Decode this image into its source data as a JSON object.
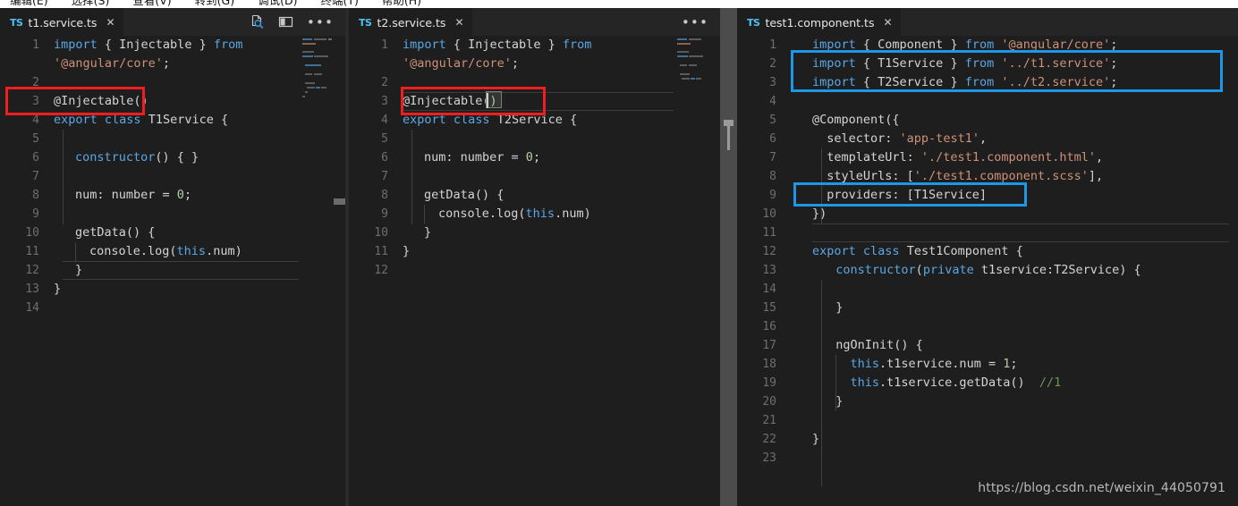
{
  "menubar": {
    "items": [
      "编辑(E)",
      "选择(S)",
      "查看(V)",
      "转到(G)",
      "调试(D)",
      "终端(T)",
      "帮助(H)"
    ]
  },
  "editor_groups": [
    {
      "tab": {
        "file_type": "TS",
        "filename": "t1.service.ts",
        "close_label": "✕"
      },
      "actions": [
        {
          "name": "open-preview-icon",
          "label": ""
        },
        {
          "name": "split-editor-icon",
          "label": ""
        },
        {
          "name": "more-actions-icon",
          "label": "•••"
        }
      ],
      "lines": [
        {
          "n": "1",
          "text": "import { Injectable } from"
        },
        {
          "n": "",
          "text": "'@angular/core';"
        },
        {
          "n": "2",
          "text": ""
        },
        {
          "n": "3",
          "text": "@Injectable()"
        },
        {
          "n": "4",
          "text": "export class T1Service {"
        },
        {
          "n": "5",
          "text": ""
        },
        {
          "n": "6",
          "text": "  constructor() { }"
        },
        {
          "n": "7",
          "text": ""
        },
        {
          "n": "8",
          "text": "  num: number = 0;"
        },
        {
          "n": "9",
          "text": ""
        },
        {
          "n": "10",
          "text": "  getData() {"
        },
        {
          "n": "11",
          "text": "    console.log(this.num)"
        },
        {
          "n": "12",
          "text": "  }"
        },
        {
          "n": "13",
          "text": "}"
        },
        {
          "n": "14",
          "text": ""
        }
      ]
    },
    {
      "tab": {
        "file_type": "TS",
        "filename": "t2.service.ts",
        "close_label": "✕"
      },
      "actions": [
        {
          "name": "more-actions-icon",
          "label": "•••"
        }
      ],
      "lines": [
        {
          "n": "1",
          "text": "import { Injectable } from"
        },
        {
          "n": "",
          "text": "'@angular/core';"
        },
        {
          "n": "2",
          "text": ""
        },
        {
          "n": "3",
          "text": "@Injectable()"
        },
        {
          "n": "4",
          "text": "export class T2Service {"
        },
        {
          "n": "5",
          "text": ""
        },
        {
          "n": "6",
          "text": "  num: number = 0;"
        },
        {
          "n": "7",
          "text": ""
        },
        {
          "n": "8",
          "text": "  getData() {"
        },
        {
          "n": "9",
          "text": "    console.log(this.num)"
        },
        {
          "n": "10",
          "text": "  }"
        },
        {
          "n": "11",
          "text": "}"
        },
        {
          "n": "12",
          "text": ""
        }
      ]
    },
    {
      "tab": {
        "file_type": "TS",
        "filename": "test1.component.ts",
        "close_label": "✕"
      },
      "actions": [],
      "lines": [
        {
          "n": "1",
          "text": "import { Component } from '@angular/core';"
        },
        {
          "n": "2",
          "text": "import { T1Service } from '../t1.service';"
        },
        {
          "n": "3",
          "text": "import { T2Service } from '../t2.service';"
        },
        {
          "n": "4",
          "text": ""
        },
        {
          "n": "5",
          "text": "@Component({"
        },
        {
          "n": "6",
          "text": "  selector: 'app-test1',"
        },
        {
          "n": "7",
          "text": "  templateUrl: './test1.component.html',"
        },
        {
          "n": "8",
          "text": "  styleUrls: ['./test1.component.scss'],"
        },
        {
          "n": "9",
          "text": "  providers: [T1Service]"
        },
        {
          "n": "10",
          "text": "})"
        },
        {
          "n": "11",
          "text": ""
        },
        {
          "n": "12",
          "text": "export class Test1Component {"
        },
        {
          "n": "13",
          "text": "  constructor(private t1service:T2Service) {"
        },
        {
          "n": "14",
          "text": ""
        },
        {
          "n": "15",
          "text": "  }"
        },
        {
          "n": "16",
          "text": ""
        },
        {
          "n": "17",
          "text": "  ngOnInit() {"
        },
        {
          "n": "18",
          "text": "    this.t1service.num = 1;"
        },
        {
          "n": "19",
          "text": "    this.t1service.getData()  //1"
        },
        {
          "n": "20",
          "text": "  }"
        },
        {
          "n": "21",
          "text": ""
        },
        {
          "n": "22",
          "text": "}"
        },
        {
          "n": "23",
          "text": ""
        }
      ]
    }
  ],
  "annotations": [
    {
      "name": "red-highlight-injectable-t1",
      "color": "#f01f1f",
      "target": "@Injectable()"
    },
    {
      "name": "red-highlight-injectable-t2",
      "color": "#f01f1f",
      "target": "@Injectable()"
    },
    {
      "name": "blue-highlight-service-imports",
      "color": "#1e97e8",
      "target": "import T1Service / T2Service"
    },
    {
      "name": "blue-highlight-providers",
      "color": "#1e97e8",
      "target": "providers: [T1Service]"
    }
  ],
  "watermark": {
    "text": "https://blog.csdn.net/weixin_44050791"
  },
  "colors": {
    "editor_bg": "#1e1e1e",
    "tabbar_bg": "#252526",
    "keyword": "#5aa7e4",
    "string": "#ce9178",
    "number": "#b5cea8",
    "comment": "#6a9955",
    "plain": "#d4d4d4",
    "linenumber": "#6e6e6e",
    "anno_red": "#f01f1f",
    "anno_blue": "#1e97e8"
  }
}
